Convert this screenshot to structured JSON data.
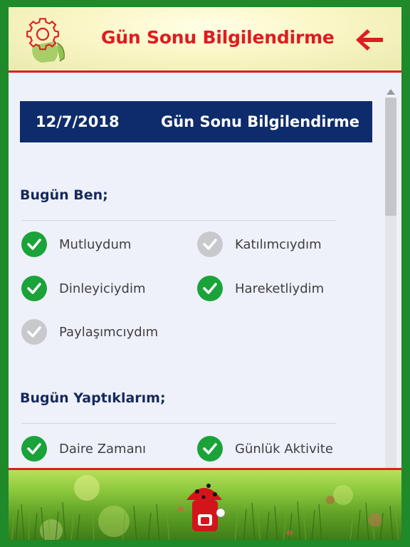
{
  "header": {
    "title": "Gün Sonu Bilgilendirme",
    "settings_icon": "gear-icon",
    "back_icon": "arrow-left-icon"
  },
  "banner": {
    "date": "12/7/2018",
    "title": "Gün Sonu Bilgilendirme"
  },
  "section_today_me": {
    "title": "Bugün Ben;",
    "items": [
      {
        "label": "Mutluydum",
        "checked": true
      },
      {
        "label": "Katılımcıydım",
        "checked": false
      },
      {
        "label": "Dinleyiciydim",
        "checked": true
      },
      {
        "label": "Hareketliydim",
        "checked": true
      },
      {
        "label": "Paylaşımcıydım",
        "checked": false
      }
    ]
  },
  "section_activities": {
    "title": "Bugün Yaptıklarım;",
    "items": [
      {
        "label": "Daire Zamanı",
        "checked": true
      },
      {
        "label": "Günlük Aktivite",
        "checked": true
      }
    ]
  },
  "colors": {
    "accent_red": "#e01c20",
    "navy": "#0e2c6b",
    "check_green": "#1aa339",
    "check_grey": "#c7c9cd",
    "frame_green": "#1e8a2a"
  }
}
